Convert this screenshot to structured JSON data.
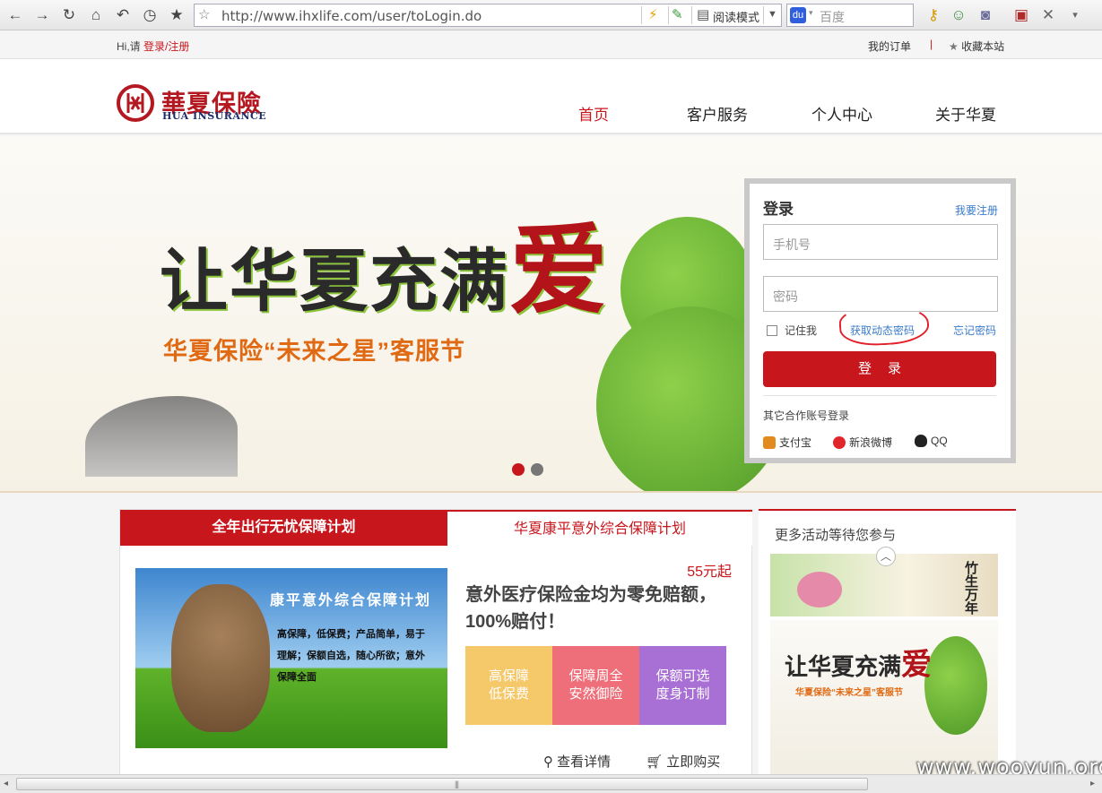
{
  "browser": {
    "url": "http://www.ihxlife.com/user/toLogin.do",
    "reader_mode": "阅读模式",
    "search_placeholder": "百度",
    "search_logo_text": "du"
  },
  "topbar": {
    "greeting": "Hi,请 ",
    "login_link": "登录",
    "slash": "/",
    "register_link": "注册",
    "my_orders": "我的订单",
    "separator": "|",
    "bookmark": "收藏本站"
  },
  "header": {
    "logo_cn": "華夏保險",
    "logo_en": "HUA INSURANCE",
    "nav": [
      {
        "label": "首页"
      },
      {
        "label": "客户服务"
      },
      {
        "label": "个人中心"
      },
      {
        "label": "关于华夏"
      }
    ]
  },
  "banner": {
    "title": "让华夏充满",
    "title_big": "爱",
    "subtitle": "华夏保险“未来之星”客服节"
  },
  "login": {
    "title": "登录",
    "register": "我要注册",
    "phone_placeholder": "手机号",
    "password_placeholder": "密码",
    "remember": "记住我",
    "dynamic_password": "获取动态密码",
    "forgot": "忘记密码",
    "submit": "登录",
    "other_title": "其它合作账号登录",
    "partners": [
      "支付宝",
      "新浪微博",
      "QQ"
    ]
  },
  "product": {
    "tabs": [
      "全年出行无忧保障计划",
      "华夏康平意外综合保障计划"
    ],
    "image_title": "康平意外综合保障计划",
    "image_text": "高保障，低保费；产品简单，易于理解；保额自选，随心所欲；意外保障全面",
    "price": "55元起",
    "headline": "意外医疗保险金均为零免赔额，100%赔付！",
    "features": [
      {
        "line1": "高保障",
        "line2": "低保费",
        "color": "#f5c869"
      },
      {
        "line1": "保障周全",
        "line2": "安然御险",
        "color": "#ee6f7a"
      },
      {
        "line1": "保额可选",
        "line2": "度身订制",
        "color": "#a86fd4"
      }
    ],
    "details": "查看详情",
    "buy": "立即购买"
  },
  "side": {
    "title": "更多活动等待您参与",
    "promo1_text": "竹生万年",
    "promo2_title": "让华夏充满",
    "promo2_big": "爱",
    "promo2_sub": "华夏保险“未来之星”客服节"
  },
  "watermark": "www.wooyun.org",
  "scrollbar": {
    "left_arrow": "◂",
    "right_arrow": "▸",
    "grip": "|||"
  }
}
